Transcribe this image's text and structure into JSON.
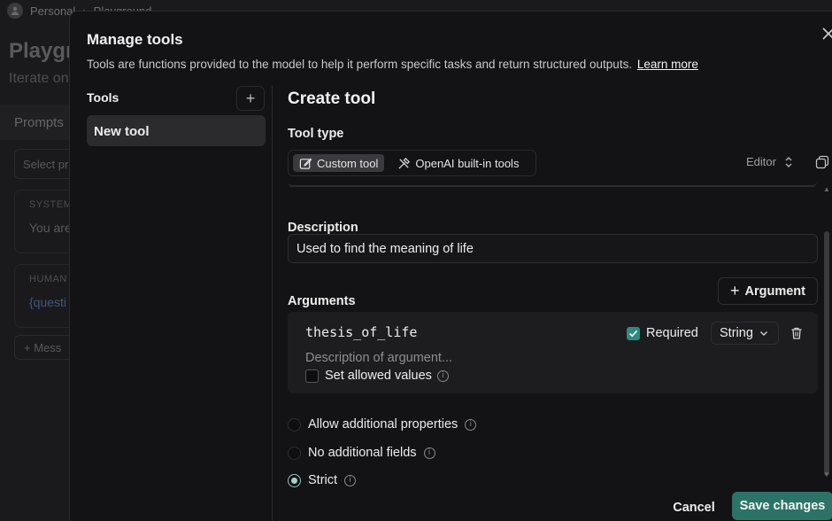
{
  "background": {
    "breadcrumb": [
      "Personal",
      "Playground"
    ],
    "title": "Playgro",
    "subtitle": "Iterate on",
    "tab": "Prompts",
    "select_placeholder": "Select pr",
    "cards": [
      {
        "label": "SYSTEM",
        "text": "You are"
      },
      {
        "label": "HUMAN",
        "text": "{questi"
      }
    ],
    "message_button": "Mess"
  },
  "modal": {
    "title": "Manage tools",
    "description": "Tools are functions provided to the model to help it perform specific tasks and return structured outputs.",
    "learn_more": "Learn more",
    "tools_label": "Tools",
    "tools": [
      {
        "label": "New tool",
        "selected": true
      }
    ],
    "create_title": "Create tool",
    "tool_type_label": "Tool type",
    "tool_types": [
      {
        "label": "Custom tool",
        "icon": "edit-icon",
        "active": true
      },
      {
        "label": "OpenAI built-in tools",
        "icon": "tools-icon",
        "active": false
      }
    ],
    "editor_label": "Editor",
    "description_label": "Description",
    "description_value": "Used to find the meaning of life",
    "arguments_label": "Arguments",
    "add_argument_label": "Argument",
    "arguments": [
      {
        "name": "thesis_of_life",
        "description_placeholder": "Description of argument...",
        "required": true,
        "required_label": "Required",
        "type": "String",
        "allowed_values_label": "Set allowed values",
        "allowed_values_checked": false
      }
    ],
    "schema_options": [
      {
        "label": "Allow additional properties",
        "selected": false
      },
      {
        "label": "No additional fields",
        "selected": false
      },
      {
        "label": "Strict",
        "selected": true
      }
    ],
    "cancel_label": "Cancel",
    "save_label": "Save changes"
  },
  "colors": {
    "accent": "#2b7367",
    "checkbox_on": "#2e8a7e",
    "background": "#131315"
  }
}
